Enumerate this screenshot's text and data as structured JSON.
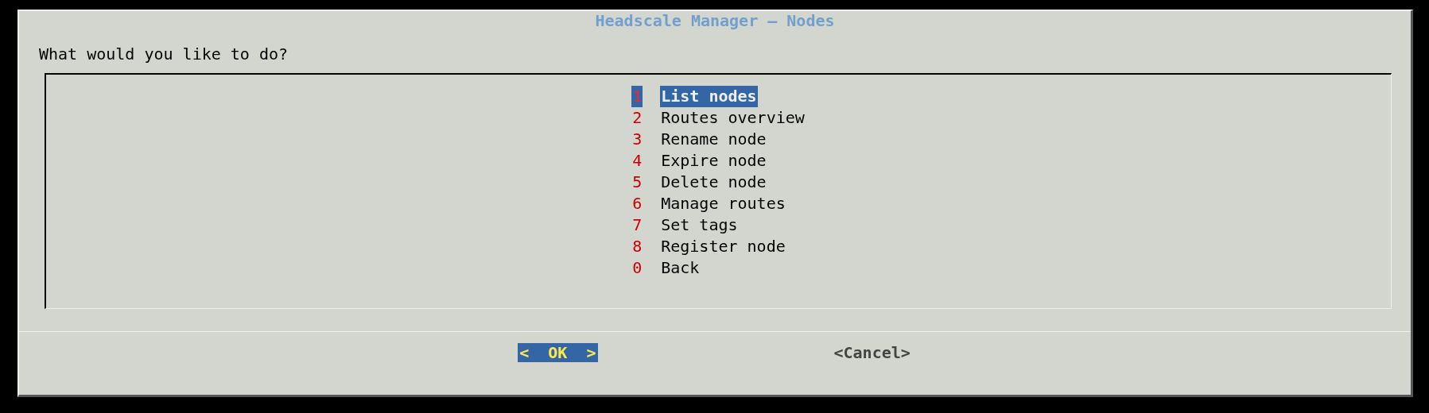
{
  "dialog": {
    "title": "Headscale Manager — Nodes",
    "prompt": "What would you like to do?"
  },
  "menu": [
    {
      "key": "1",
      "label": "List nodes",
      "selected": true
    },
    {
      "key": "2",
      "label": "Routes overview",
      "selected": false
    },
    {
      "key": "3",
      "label": "Rename node",
      "selected": false
    },
    {
      "key": "4",
      "label": "Expire node",
      "selected": false
    },
    {
      "key": "5",
      "label": "Delete node",
      "selected": false
    },
    {
      "key": "6",
      "label": "Manage routes",
      "selected": false
    },
    {
      "key": "7",
      "label": "Set tags",
      "selected": false
    },
    {
      "key": "8",
      "label": "Register node",
      "selected": false
    },
    {
      "key": "0",
      "label": "Back",
      "selected": false
    }
  ],
  "buttons": [
    {
      "label": "<  OK  >",
      "selected": true
    },
    {
      "label": "<Cancel>",
      "selected": false
    }
  ]
}
